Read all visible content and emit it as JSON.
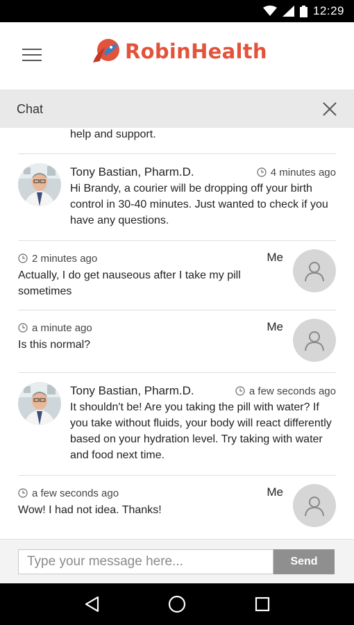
{
  "status_bar": {
    "time": "12:29",
    "icons": [
      "wifi-icon",
      "signal-icon",
      "battery-icon"
    ]
  },
  "header": {
    "menu_icon": "hamburger-menu-icon",
    "brand_name": "RobinHealth",
    "brand_color": "#e2533b",
    "logo_icon": "robin-bird-icon"
  },
  "chat": {
    "title": "Chat",
    "close_icon": "close-icon"
  },
  "messages": {
    "fragment": {
      "text": "help and support."
    },
    "items": [
      {
        "sender": "Tony Bastian, Pharm.D.",
        "time": "4 minutes ago",
        "text": "Hi Brandy, a courier will be dropping off your birth control in 30-40 minutes. Just wanted to check if you have any questions.",
        "avatar": "pharmacist-photo"
      },
      {
        "sender": "Me",
        "time": "2 minutes ago",
        "text": "Actually, I do get nauseous after I take my pill sometimes",
        "avatar": "user-avatar-icon"
      },
      {
        "sender": "Me",
        "time": "a minute ago",
        "text": "Is this normal?",
        "avatar": "user-avatar-icon"
      },
      {
        "sender": "Tony Bastian, Pharm.D.",
        "time": "a few seconds ago",
        "text": "It shouldn't be! Are you taking the pill with water? If you take without fluids, your body will react differently based on your hydration level. Try taking with water and food next time.",
        "avatar": "pharmacist-photo"
      },
      {
        "sender": "Me",
        "time": "a few seconds ago",
        "text": "Wow! I had not idea. Thanks!",
        "avatar": "user-avatar-icon"
      }
    ]
  },
  "composer": {
    "placeholder": "Type your message here...",
    "value": "",
    "send_label": "Send"
  },
  "nav": {
    "icons": [
      "back-icon",
      "home-icon",
      "recents-icon"
    ]
  }
}
